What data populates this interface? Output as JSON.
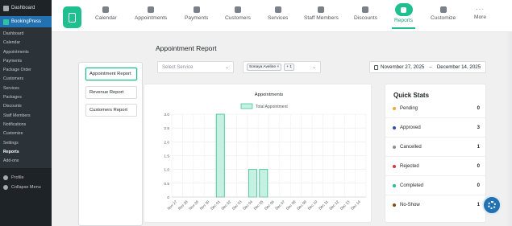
{
  "wp_sidebar": {
    "dashboard": "Dashboard",
    "plugin": "BookingPress",
    "submenu": [
      "Dashboard",
      "Calendar",
      "Appointments",
      "Payments",
      "Package Order",
      "Customers",
      "Services",
      "Packages",
      "Discounts",
      "Staff Members",
      "Notifications",
      "Customize",
      "Settings",
      "Reports",
      "Add-ons"
    ],
    "current": "Reports",
    "profile": "Profile",
    "collapse": "Collapse Menu"
  },
  "nav": {
    "items": [
      "Calendar",
      "Appointments",
      "Payments",
      "Customers",
      "Services",
      "Staff Members",
      "Discounts",
      "Reports",
      "Customize",
      "More"
    ],
    "active": "Reports"
  },
  "page": {
    "title": "Appointment Report",
    "tabs": [
      "Appointment Report",
      "Revenue Report",
      "Customers Report"
    ],
    "service_placeholder": "Select Service",
    "staff_chip": "Sonaya Aveline",
    "staff_more": "+ 1",
    "date_from": "November 27, 2025",
    "date_to": "December 14, 2025",
    "date_sep": "–"
  },
  "chart_data": {
    "type": "bar",
    "title": "Appointments",
    "legend": "Total Appointment",
    "categories": [
      "Nov 27",
      "Nov 28",
      "Nov 29",
      "Nov 30",
      "Dec 01",
      "Dec 02",
      "Dec 03",
      "Dec 04",
      "Dec 05",
      "Dec 06",
      "Dec 07",
      "Dec 08",
      "Dec 09",
      "Dec 10",
      "Dec 11",
      "Dec 12",
      "Dec 13",
      "Dec 14"
    ],
    "values": [
      0,
      0,
      0,
      0,
      3,
      0,
      0,
      1,
      1,
      0,
      0,
      0,
      0,
      0,
      0,
      0,
      0,
      0
    ],
    "yticks": [
      "3.0",
      "2.5",
      "2.0",
      "1.5",
      "1.0",
      "0.5",
      "0"
    ],
    "ylim": [
      0,
      3
    ],
    "grid": true,
    "legend_position": "top",
    "bar_fill": "#c6f0e2",
    "bar_stroke": "#2fbf8c"
  },
  "stats": {
    "title": "Quick Stats",
    "rows": [
      {
        "label": "Pending",
        "value": "0",
        "color": "#f0a63a"
      },
      {
        "label": "Approved",
        "value": "3",
        "color": "#2b4fb3"
      },
      {
        "label": "Cancelled",
        "value": "1",
        "color": "#8c8f94"
      },
      {
        "label": "Rejected",
        "value": "0",
        "color": "#d63638"
      },
      {
        "label": "Completed",
        "value": "0",
        "color": "#1fbf8f"
      },
      {
        "label": "No-Show",
        "value": "1",
        "color": "#8a4b12"
      }
    ]
  }
}
